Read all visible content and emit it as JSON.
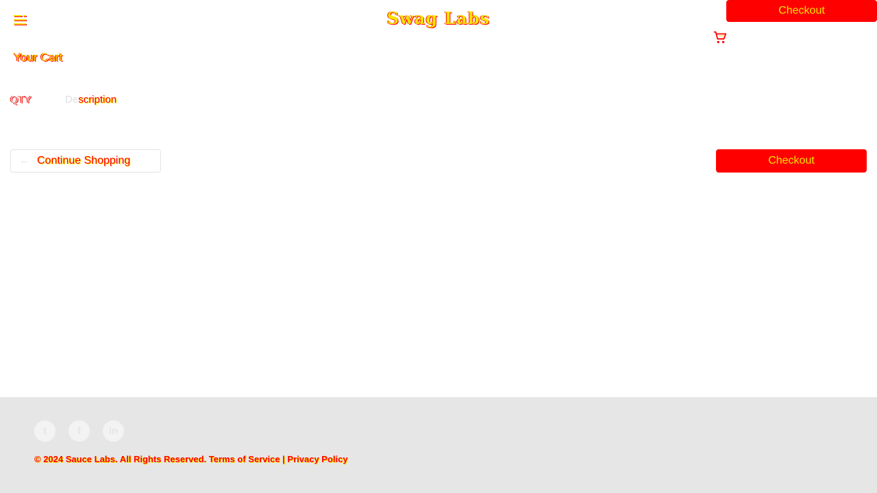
{
  "header": {
    "app_title": "Swag Labs",
    "checkout_label": "Checkout"
  },
  "icons": {
    "menu": "hamburger-menu-icon",
    "cart": "shopping-cart-icon",
    "back": "arrow-left-icon",
    "social": [
      "twitter-icon",
      "facebook-icon",
      "linkedin-icon"
    ]
  },
  "page": {
    "title": "Your Cart"
  },
  "cart_table": {
    "qty_header": "QTY",
    "desc_header_prefix": "De",
    "desc_header_rest": "scription"
  },
  "actions": {
    "continue_label": "Continue Shopping",
    "back_glyph": "←",
    "checkout_label": "Checkout"
  },
  "footer": {
    "social": [
      {
        "label": "t"
      },
      {
        "label": "f"
      },
      {
        "label": "in"
      }
    ],
    "copyright": "© 2024 Sauce Labs. All Rights Reserved. Terms of Service | Privacy Policy"
  },
  "colors": {
    "accent": "#ff0000",
    "text_glitch": "#f5e400",
    "footer_bg": "#e6e6e6"
  }
}
